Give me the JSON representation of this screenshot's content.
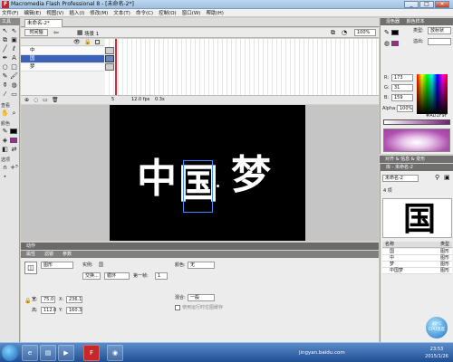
{
  "window": {
    "title": "Macromedia Flash Professional 8 - [未命名-2*]",
    "app_icon_label": "F",
    "min": "_",
    "max": "□",
    "close": "✕"
  },
  "menubar": [
    "文件(F)",
    "编辑(E)",
    "视图(V)",
    "插入(I)",
    "修改(M)",
    "文本(T)",
    "命令(C)",
    "控制(O)",
    "窗口(W)",
    "帮助(H)"
  ],
  "tools": {
    "header": "工具",
    "section_view": "查看",
    "section_colors": "颜色",
    "section_options": "选项"
  },
  "document": {
    "tab": "未命名-2*",
    "timeline_button": "时间轴",
    "scene": "场景 1",
    "zoom": "100%"
  },
  "timeline": {
    "layers": [
      "中",
      "国",
      "梦"
    ],
    "selected_layer": "国",
    "frame_number": "5",
    "fps": "12.0 fps",
    "time": "0.3s"
  },
  "stage": {
    "chars": [
      "中",
      "国",
      "梦"
    ],
    "background": "#000000"
  },
  "panels": {
    "actions": "动作",
    "properties_tabs": [
      "属性",
      "滤镜",
      "参数"
    ]
  },
  "properties": {
    "type": "图形",
    "instance_label": "实例:",
    "instance_value": "国",
    "swap_button": "交换...",
    "loop": "循环",
    "first_frame_label": "第一帧:",
    "first_frame_value": "1",
    "color_label": "颜色:",
    "color_value": "无",
    "blend_label": "混合:",
    "blend_value": "一般",
    "cache_checkbox": "使用运行时位图缓存",
    "w_label": "宽:",
    "w_value": "75.0",
    "x_label": "X:",
    "x_value": "236.1",
    "h_label": "高:",
    "h_value": "112.0",
    "y_label": "Y:",
    "y_value": "160.3"
  },
  "color_panel": {
    "title_tabs": [
      "混色器",
      "颜色样本"
    ],
    "type_label": "类型:",
    "type_value": "放射状",
    "overflow_label": "溢出:",
    "r": "173",
    "g": "31",
    "b": "159",
    "alpha_label": "Alpha:",
    "alpha": "100%",
    "hex": "#AD1F9F"
  },
  "align_panel": {
    "title": "对齐 & 信息 & 变形"
  },
  "library": {
    "title": "库 - 未命名-2",
    "doc": "未命名-2",
    "count": "4 项",
    "col_name": "名称",
    "col_kind": "类型",
    "items": [
      {
        "name": "国",
        "kind": "图形"
      },
      {
        "name": "中",
        "kind": "图形"
      },
      {
        "name": "梦",
        "kind": "图形"
      },
      {
        "name": "中国梦",
        "kind": "图形"
      }
    ]
  },
  "taskbar": {
    "time": "23:53",
    "date": "2015/1/26",
    "cpu_temp": "39°C",
    "cpu_label": "CPU温度",
    "watermark": "jingyan.baidu.com"
  },
  "colors": {
    "accent": "#3b62b8",
    "playhead": "#e3262c",
    "stage": "#000000",
    "magenta": "#ad1f9f"
  }
}
